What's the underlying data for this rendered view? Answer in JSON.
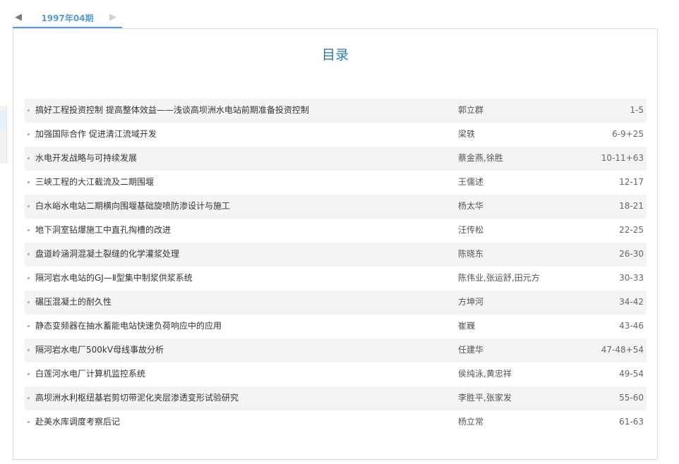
{
  "issue_tab": {
    "label": "1997年04期",
    "prev_icon": "◀",
    "next_icon": "▶"
  },
  "toc_title": "目录",
  "articles": [
    {
      "title": "搞好工程投资控制 提高整体效益——浅谈高坝洲水电站前期准备投资控制",
      "authors": "郭立群",
      "pages": "1-5"
    },
    {
      "title": "加强国际合作 促进清江流域开发",
      "authors": "梁轶",
      "pages": "6-9+25"
    },
    {
      "title": "水电开发战略与可持续发展",
      "authors": "蔡金燕,徐胜",
      "pages": "10-11+63"
    },
    {
      "title": "三峡工程的大江截流及二期围堰",
      "authors": "王儒述",
      "pages": "12-17"
    },
    {
      "title": "白水峪水电站二期横向围堰基础旋喷防渗设计与施工",
      "authors": "杨太华",
      "pages": "18-21"
    },
    {
      "title": "地下洞室钻爆施工中直孔掏槽的改进",
      "authors": "汪传松",
      "pages": "22-25"
    },
    {
      "title": "盘道岭涵洞混凝土裂缝的化学灌浆处理",
      "authors": "陈晓东",
      "pages": "26-30"
    },
    {
      "title": "隔河岩水电站的GJ—Ⅱ型集中制浆供浆系统",
      "authors": "陈伟业,张运舒,田元方",
      "pages": "30-33"
    },
    {
      "title": "碾压混凝土的耐久性",
      "authors": "方坤河",
      "pages": "34-42"
    },
    {
      "title": "静态变频器在抽水蓄能电站快速负荷响应中的应用",
      "authors": "崔巍",
      "pages": "43-46"
    },
    {
      "title": "隔河岩水电厂500kV母线事故分析",
      "authors": "任建华",
      "pages": "47-48+54"
    },
    {
      "title": "白莲河水电厂计算机监控系统",
      "authors": "侯纯泳,黄忠祥",
      "pages": "49-54"
    },
    {
      "title": "高坝洲水利枢纽基岩剪切带泥化夹层渗透变形试验研究",
      "authors": "李胜平,张家发",
      "pages": "55-60"
    },
    {
      "title": "赴美水库调度考察后记",
      "authors": "杨立常",
      "pages": "61-63"
    }
  ]
}
